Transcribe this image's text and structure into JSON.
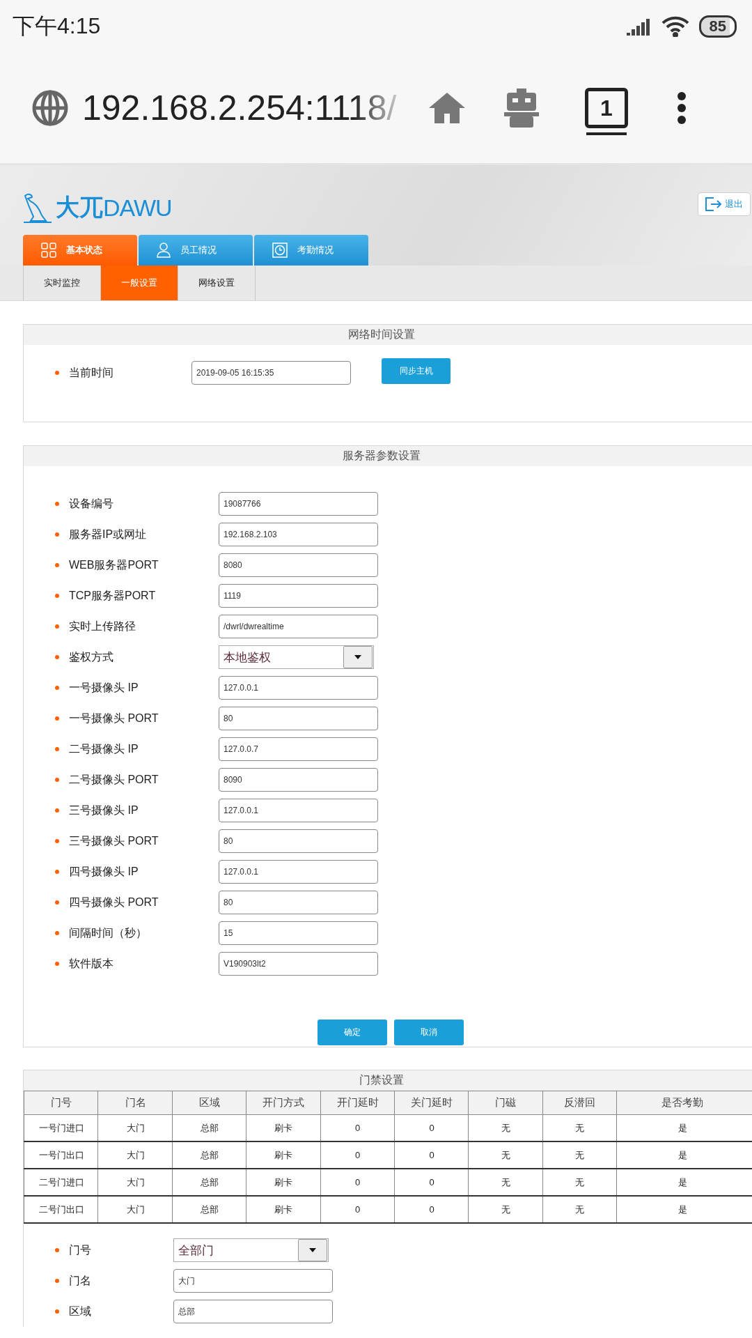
{
  "status_bar": {
    "time": "下午4:15",
    "battery": "85"
  },
  "browser": {
    "url": "192.168.2.254:1118/",
    "tab_count": "1"
  },
  "header": {
    "logo_cn": "大兀",
    "logo_en": "DAWU",
    "logout": "退出"
  },
  "main_tabs": [
    {
      "label": "基本状态",
      "selected": true
    },
    {
      "label": "员工情况",
      "selected": false
    },
    {
      "label": "考勤情况",
      "selected": false
    }
  ],
  "sub_tabs": [
    {
      "label": "实时监控",
      "selected": false
    },
    {
      "label": "一般设置",
      "selected": true
    },
    {
      "label": "网络设置",
      "selected": false
    }
  ],
  "time_section": {
    "title": "网络时间设置",
    "label": "当前时间",
    "value": "2019-09-05 16:15:35",
    "button": "同步主机"
  },
  "server_section": {
    "title": "服务器参数设置",
    "fields": [
      {
        "label": "设备编号",
        "kind": "input",
        "value": "19087766"
      },
      {
        "label": "服务器IP或网址",
        "kind": "input",
        "value": "192.168.2.103"
      },
      {
        "label": "WEB服务器PORT",
        "kind": "input",
        "value": "8080"
      },
      {
        "label": "TCP服务器PORT",
        "kind": "input",
        "value": "1119"
      },
      {
        "label": "实时上传路径",
        "kind": "input",
        "value": "/dwrl/dwrealtime"
      },
      {
        "label": "鉴权方式",
        "kind": "select",
        "value": "本地鉴权"
      },
      {
        "label": "一号摄像头 IP",
        "kind": "input",
        "value": "127.0.0.1"
      },
      {
        "label": "一号摄像头 PORT",
        "kind": "input",
        "value": "80"
      },
      {
        "label": "二号摄像头 IP",
        "kind": "input",
        "value": "127.0.0.7"
      },
      {
        "label": "二号摄像头 PORT",
        "kind": "input",
        "value": "8090"
      },
      {
        "label": "三号摄像头 IP",
        "kind": "input",
        "value": "127.0.0.1"
      },
      {
        "label": "三号摄像头 PORT",
        "kind": "input",
        "value": "80"
      },
      {
        "label": "四号摄像头 IP",
        "kind": "input",
        "value": "127.0.0.1"
      },
      {
        "label": "四号摄像头 PORT",
        "kind": "input",
        "value": "80"
      },
      {
        "label": "间隔时间（秒）",
        "kind": "input",
        "value": "15"
      },
      {
        "label": "软件版本",
        "kind": "input",
        "value": "V190903lt2"
      }
    ],
    "buttons": [
      "确定",
      "取消"
    ]
  },
  "door_section": {
    "title": "门禁设置",
    "columns": [
      "门号",
      "门名",
      "区域",
      "开门方式",
      "开门延时",
      "关门延时",
      "门磁",
      "反潜回",
      "是否考勤"
    ],
    "rows": [
      [
        "一号门进口",
        "大门",
        "总部",
        "刷卡",
        "0",
        "0",
        "无",
        "无",
        "是"
      ],
      [
        "一号门出口",
        "大门",
        "总部",
        "刷卡",
        "0",
        "0",
        "无",
        "无",
        "是"
      ],
      [
        "二号门进口",
        "大门",
        "总部",
        "刷卡",
        "0",
        "0",
        "无",
        "无",
        "是"
      ],
      [
        "二号门出口",
        "大门",
        "总部",
        "刷卡",
        "0",
        "0",
        "无",
        "无",
        "是"
      ]
    ],
    "fields": [
      {
        "label": "门号",
        "kind": "select",
        "value": "全部门"
      },
      {
        "label": "门名",
        "kind": "input",
        "value": "大门"
      },
      {
        "label": "区域",
        "kind": "input",
        "value": "总部"
      }
    ]
  }
}
